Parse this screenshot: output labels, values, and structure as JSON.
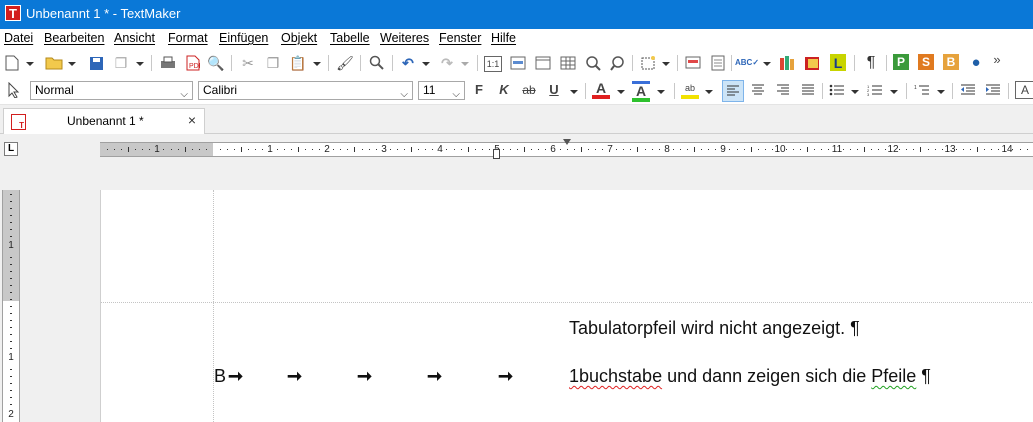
{
  "window": {
    "title": "Unbenannt 1 * - TextMaker",
    "app_icon_letter": "T"
  },
  "menu": [
    "Datei",
    "Bearbeiten",
    "Ansicht",
    "Format",
    "Einfügen",
    "Objekt",
    "Tabelle",
    "Weiteres",
    "Fenster",
    "Hilfe"
  ],
  "format_bar": {
    "style": "Normal",
    "font": "Calibri",
    "size": "11",
    "bold": "F",
    "italic": "K",
    "strike": "ab",
    "underline": "U",
    "more_symbol": "»"
  },
  "tab": {
    "label": "Unbenannt 1 *",
    "close": "×"
  },
  "ruler": {
    "tab_selector": "L",
    "negative_label": "1",
    "numbers": [
      "1",
      "2",
      "3",
      "4",
      "5",
      "6",
      "7",
      "8",
      "9",
      "10",
      "11",
      "12",
      "13",
      "14"
    ]
  },
  "vruler": {
    "labels": [
      "1",
      "1",
      "2"
    ]
  },
  "document": {
    "line1": "Tabulatorpfeil wird nicht angezeigt. ¶",
    "line2_start": "B",
    "arrow_symbol": "➞",
    "line2_word1": "1buchstabe",
    "line2_middle": " und dann zeigen sich die ",
    "line2_word2": "Pfeile",
    "line2_end": " ¶"
  },
  "colors": {
    "titlebar": "#0a78d7",
    "accent_red": "#d21e1e",
    "font_color_bar": "#e02020",
    "highlight_bar": "#2ec12e"
  }
}
